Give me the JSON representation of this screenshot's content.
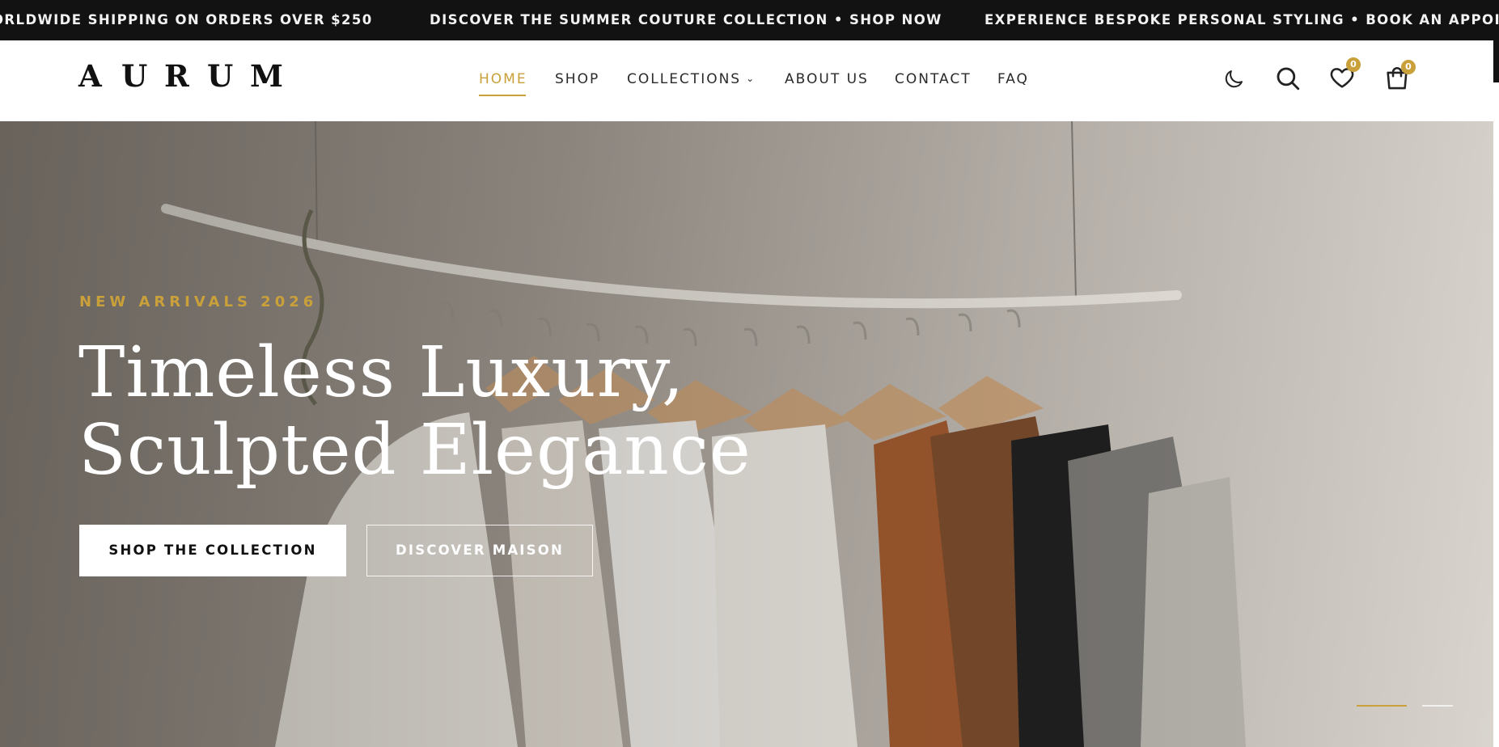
{
  "announcement": {
    "messages": [
      "ORLDWIDE SHIPPING ON ORDERS OVER $250",
      "DISCOVER THE SUMMER COUTURE COLLECTION • SHOP NOW",
      "EXPERIENCE BESPOKE PERSONAL STYLING • BOOK AN APPOINTM"
    ]
  },
  "header": {
    "logo_letters": [
      "A",
      "U",
      "R",
      "U",
      "M"
    ],
    "nav": [
      {
        "label": "HOME",
        "active": true
      },
      {
        "label": "SHOP"
      },
      {
        "label": "COLLECTIONS",
        "has_dropdown": true
      },
      {
        "label": "ABOUT US"
      },
      {
        "label": "CONTACT"
      },
      {
        "label": "FAQ"
      }
    ],
    "icons": {
      "theme": "moon-icon",
      "search": "search-icon",
      "wishlist": "heart-icon",
      "cart": "shopping-bag-icon"
    },
    "wishlist_count": "0",
    "cart_count": "0"
  },
  "hero": {
    "eyebrow": "NEW ARRIVALS 2026",
    "headline_line1": "Timeless Luxury,",
    "headline_line2": "Sculpted Elegance",
    "primary_cta": "SHOP THE COLLECTION",
    "secondary_cta": "DISCOVER MAISON",
    "slides": {
      "total": 2,
      "active": 1
    }
  },
  "colors": {
    "accent": "#c9a03a",
    "announcement_bg": "#121212",
    "text_dark": "#111111"
  }
}
